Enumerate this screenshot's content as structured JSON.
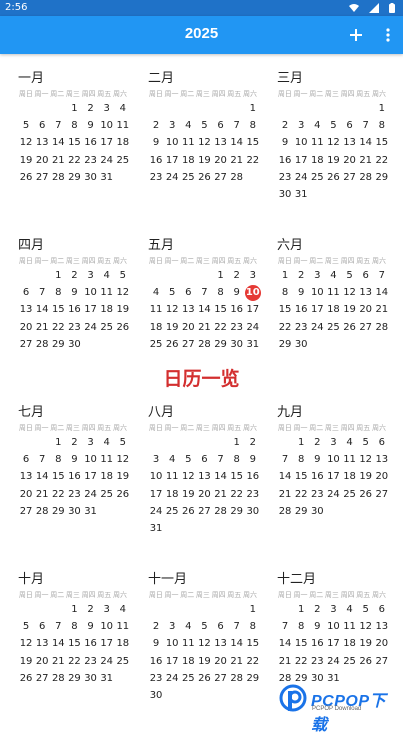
{
  "status_bar": {
    "time": "2:56"
  },
  "app_bar": {
    "title": "2025",
    "add_icon": "plus-icon",
    "more_icon": "more-vert-icon"
  },
  "weekdays": [
    "周日",
    "周一",
    "周二",
    "周三",
    "周四",
    "周五",
    "周六"
  ],
  "months": [
    {
      "name": "一月",
      "offset": 3,
      "days": 31
    },
    {
      "name": "二月",
      "offset": 6,
      "days": 28
    },
    {
      "name": "三月",
      "offset": 6,
      "days": 31
    },
    {
      "name": "四月",
      "offset": 2,
      "days": 30
    },
    {
      "name": "五月",
      "offset": 4,
      "days": 31,
      "today": 10
    },
    {
      "name": "六月",
      "offset": 0,
      "days": 30
    },
    {
      "name": "七月",
      "offset": 2,
      "days": 31
    },
    {
      "name": "八月",
      "offset": 5,
      "days": 31
    },
    {
      "name": "九月",
      "offset": 1,
      "days": 30
    },
    {
      "name": "十月",
      "offset": 3,
      "days": 31
    },
    {
      "name": "十一月",
      "offset": 6,
      "days": 30
    },
    {
      "name": "十二月",
      "offset": 1,
      "days": 31
    }
  ],
  "overlay_caption": "日历一览",
  "watermark": {
    "text": "PCPOP下载",
    "subtext": "PCPOP Download"
  },
  "colors": {
    "app_bar": "#2196f3",
    "status_bar": "#1f72c8",
    "today": "#e53935",
    "caption": "#d32f2f"
  }
}
